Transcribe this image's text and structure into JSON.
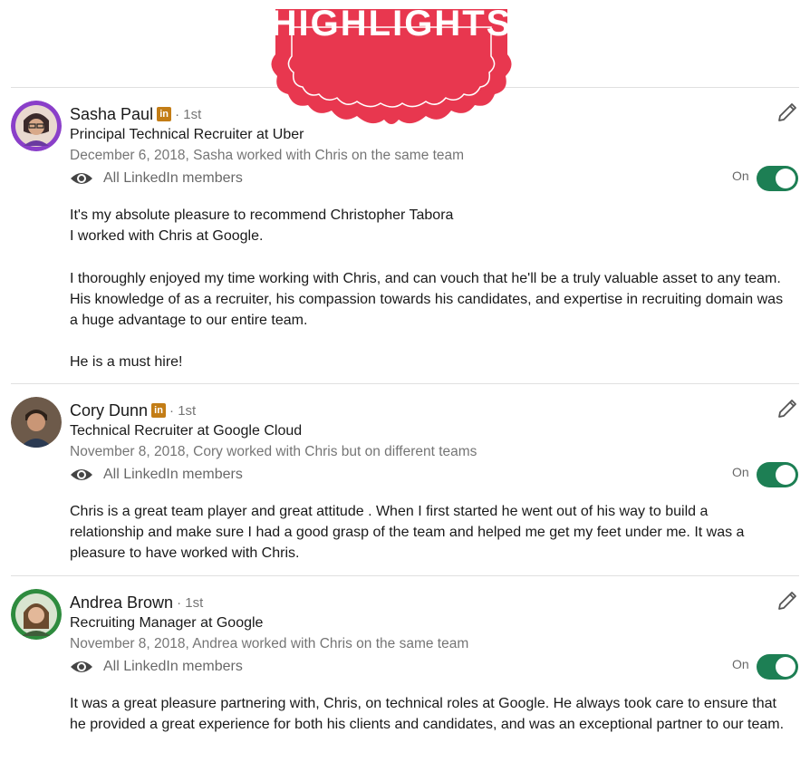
{
  "banner": {
    "title": "HIGHLIGHTS",
    "color": "#e8374f"
  },
  "recommendations": [
    {
      "name": "Sasha Paul",
      "has_linkedin_badge": true,
      "badge_text": "in",
      "degree": "· 1st",
      "headline": "Principal Technical Recruiter at Uber",
      "relation": "December 6, 2018, Sasha worked with Chris on the same team",
      "visibility": "All LinkedIn members",
      "toggle_label": "On",
      "toggle_on": true,
      "paragraphs": [
        "It's my absolute pleasure to recommend Christopher Tabora",
        "I worked with Chris at Google.",
        "I thoroughly enjoyed my time working with Chris, and can vouch that he'll be a truly valuable asset to any team. His knowledge of as a recruiter, his compassion towards his candidates, and expertise in recruiting domain was a huge advantage to our entire team.",
        "He is a must hire!"
      ]
    },
    {
      "name": "Cory Dunn",
      "has_linkedin_badge": true,
      "badge_text": "in",
      "degree": "· 1st",
      "headline": "Technical Recruiter at Google Cloud",
      "relation": "November 8, 2018, Cory worked with Chris but on different teams",
      "visibility": "All LinkedIn members",
      "toggle_label": "On",
      "toggle_on": true,
      "paragraphs": [
        "Chris is a great team player and great attitude . When I first started he went out of his way to build a relationship and make sure I had a good grasp of the team and helped me get my feet under me. It was a pleasure to have worked with Chris."
      ]
    },
    {
      "name": "Andrea Brown",
      "has_linkedin_badge": false,
      "degree": "· 1st",
      "headline": "Recruiting Manager at Google",
      "relation": "November 8, 2018, Andrea worked with Chris on the same team",
      "visibility": "All LinkedIn members",
      "toggle_label": "On",
      "toggle_on": true,
      "paragraphs": [
        "It was a great pleasure partnering with, Chris, on technical roles at Google. He always took care to ensure that he provided a great experience for both his clients and candidates, and was an exceptional partner to our team."
      ]
    }
  ]
}
